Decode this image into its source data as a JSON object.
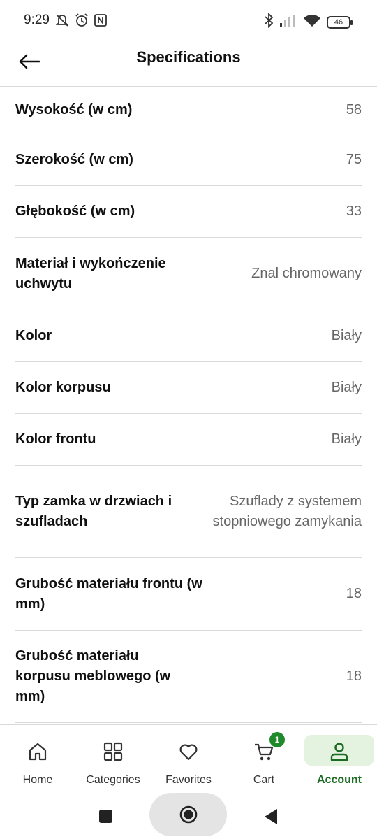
{
  "status_bar": {
    "time": "9:29",
    "battery": "46",
    "left_icons": [
      "mute-icon",
      "alarm-icon",
      "nfc-icon"
    ],
    "right_icons": [
      "bluetooth-icon",
      "signal-icon",
      "wifi-icon",
      "battery-icon"
    ]
  },
  "header": {
    "title": "Specifications",
    "back_icon": "arrow-left-icon"
  },
  "specs": [
    {
      "label": "Wysokość (w cm)",
      "value": "58"
    },
    {
      "label": "Szerokość (w cm)",
      "value": "75"
    },
    {
      "label": "Głębokość (w cm)",
      "value": "33"
    },
    {
      "label": "Materiał i wykończenie uchwytu",
      "value": "Znal chromowany"
    },
    {
      "label": "Kolor",
      "value": "Biały"
    },
    {
      "label": "Kolor korpusu",
      "value": "Biały"
    },
    {
      "label": "Kolor frontu",
      "value": "Biały"
    },
    {
      "label": "Typ zamka w drzwiach i szufladach",
      "value": "Szuflady z systemem stopniowego zamykania"
    },
    {
      "label": "Grubość materiału frontu (w mm)",
      "value": "18"
    },
    {
      "label": "Grubość materiału korpusu meblowego (w mm)",
      "value": "18"
    }
  ],
  "nav": {
    "home": "Home",
    "categories": "Categories",
    "favorites": "Favorites",
    "cart": "Cart",
    "cart_badge": "1",
    "account": "Account",
    "active": "account",
    "active_color": "#1b6b24",
    "badge_color": "#1e8a2a"
  }
}
